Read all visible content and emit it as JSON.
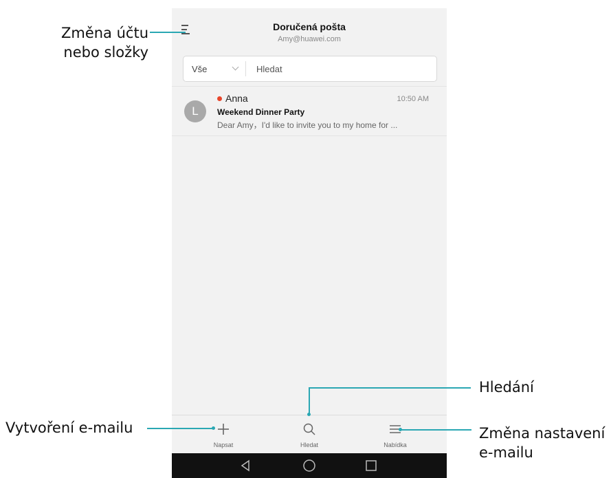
{
  "header": {
    "title": "Doručená pošta",
    "subtitle": "Amy@huawei.com"
  },
  "search": {
    "filter_label": "Vše",
    "placeholder": "Hledat"
  },
  "messages": [
    {
      "avatar_letter": "L",
      "sender": "Anna",
      "time": "10:50 AM",
      "subject": "Weekend Dinner Party",
      "preview": "Dear Amy，I'd like to invite you to my home for ..."
    }
  ],
  "bottom_bar": {
    "compose_label": "Napsat",
    "search_label": "Hledat",
    "menu_label": "Nabídka"
  },
  "callouts": {
    "switch_account": "Změna účtu\nnebo složky",
    "search": "Hledání",
    "compose": "Vytvoření e-mailu",
    "settings": "Změna nastavení\ne-mailu"
  },
  "colors": {
    "accent_line": "#2aa7b3",
    "unread_dot": "#e8462b"
  }
}
